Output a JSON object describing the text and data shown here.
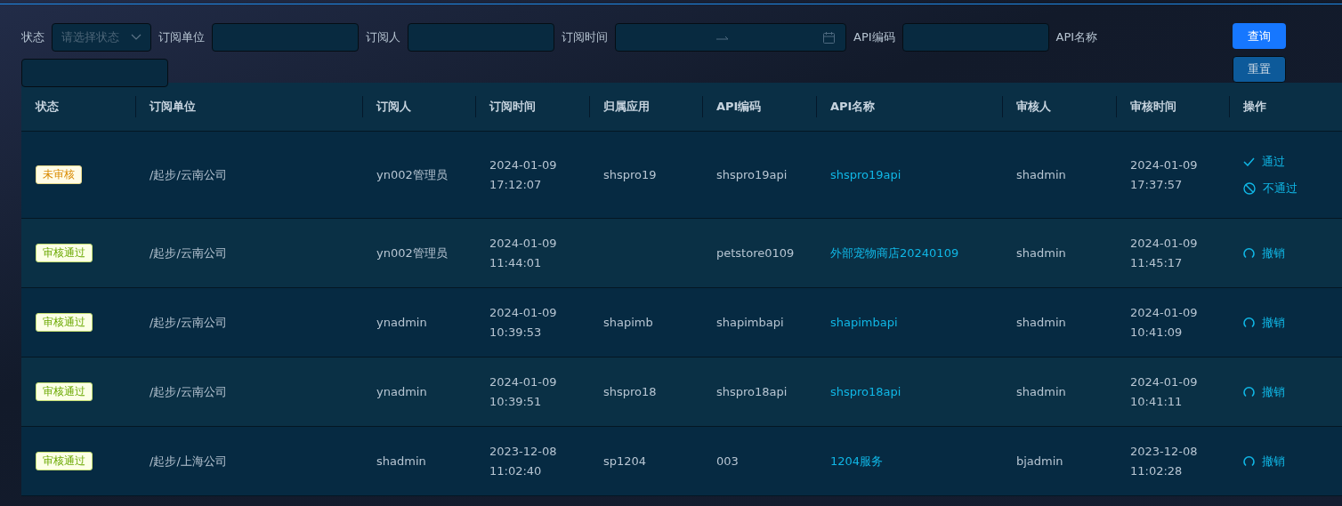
{
  "filters": [
    {
      "label": "状态",
      "kind": "select",
      "placeholder": "请选择状态"
    },
    {
      "label": "订阅单位",
      "kind": "text"
    },
    {
      "label": "订阅人",
      "kind": "text"
    },
    {
      "label": "订阅时间",
      "kind": "daterange"
    },
    {
      "label": "API编码",
      "kind": "text"
    },
    {
      "label": "API名称",
      "kind": "text"
    }
  ],
  "buttons": [
    {
      "label": "查询",
      "kind": "primary"
    },
    {
      "label": "重置",
      "kind": "secondary"
    }
  ],
  "table": {
    "columns": [
      "状态",
      "订阅单位",
      "订阅人",
      "订阅时间",
      "归属应用",
      "API编码",
      "API名称",
      "审核人",
      "审核时间",
      "操作"
    ],
    "rows": [
      {
        "status": {
          "label": "未审核",
          "kind": "pending"
        },
        "unit": "/起步/云南公司",
        "subscriber": "yn002管理员",
        "sub_time": [
          "2024-01-09",
          "17:12:07"
        ],
        "app": "shspro19",
        "api_code": "shspro19api",
        "api_name": "shspro19api",
        "reviewer": "shadmin",
        "review_time": [
          "2024-01-09",
          "17:37:57"
        ],
        "actions": [
          {
            "label": "通过",
            "kind": "approve"
          },
          {
            "label": "不通过",
            "kind": "reject"
          }
        ]
      },
      {
        "status": {
          "label": "审核通过",
          "kind": "approved"
        },
        "unit": "/起步/云南公司",
        "subscriber": "yn002管理员",
        "sub_time": [
          "2024-01-09",
          "11:44:01"
        ],
        "api_code": "petstore0109",
        "api_name": "外部宠物商店20240109",
        "reviewer": "shadmin",
        "review_time": [
          "2024-01-09",
          "11:45:17"
        ],
        "actions": [
          {
            "label": "撤销",
            "kind": "revoke"
          }
        ]
      },
      {
        "status": {
          "label": "审核通过",
          "kind": "approved"
        },
        "unit": "/起步/云南公司",
        "subscriber": "ynadmin",
        "sub_time": [
          "2024-01-09",
          "10:39:53"
        ],
        "app": "shapimb",
        "api_code": "shapimbapi",
        "api_name": "shapimbapi",
        "reviewer": "shadmin",
        "review_time": [
          "2024-01-09",
          "10:41:09"
        ],
        "actions": [
          {
            "label": "撤销",
            "kind": "revoke"
          }
        ]
      },
      {
        "status": {
          "label": "审核通过",
          "kind": "approved"
        },
        "unit": "/起步/云南公司",
        "subscriber": "ynadmin",
        "sub_time": [
          "2024-01-09",
          "10:39:51"
        ],
        "app": "shspro18",
        "api_code": "shspro18api",
        "api_name": "shspro18api",
        "reviewer": "shadmin",
        "review_time": [
          "2024-01-09",
          "10:41:11"
        ],
        "actions": [
          {
            "label": "撤销",
            "kind": "revoke"
          }
        ]
      },
      {
        "status": {
          "label": "审核通过",
          "kind": "approved"
        },
        "unit": "/起步/上海公司",
        "subscriber": "shadmin",
        "sub_time": [
          "2023-12-08",
          "11:02:40"
        ],
        "app": "sp1204",
        "api_code": "003",
        "api_name": "1204服务",
        "reviewer": "bjadmin",
        "review_time": [
          "2023-12-08",
          "11:02:28"
        ],
        "actions": [
          {
            "label": "撤销",
            "kind": "revoke"
          }
        ]
      }
    ]
  }
}
